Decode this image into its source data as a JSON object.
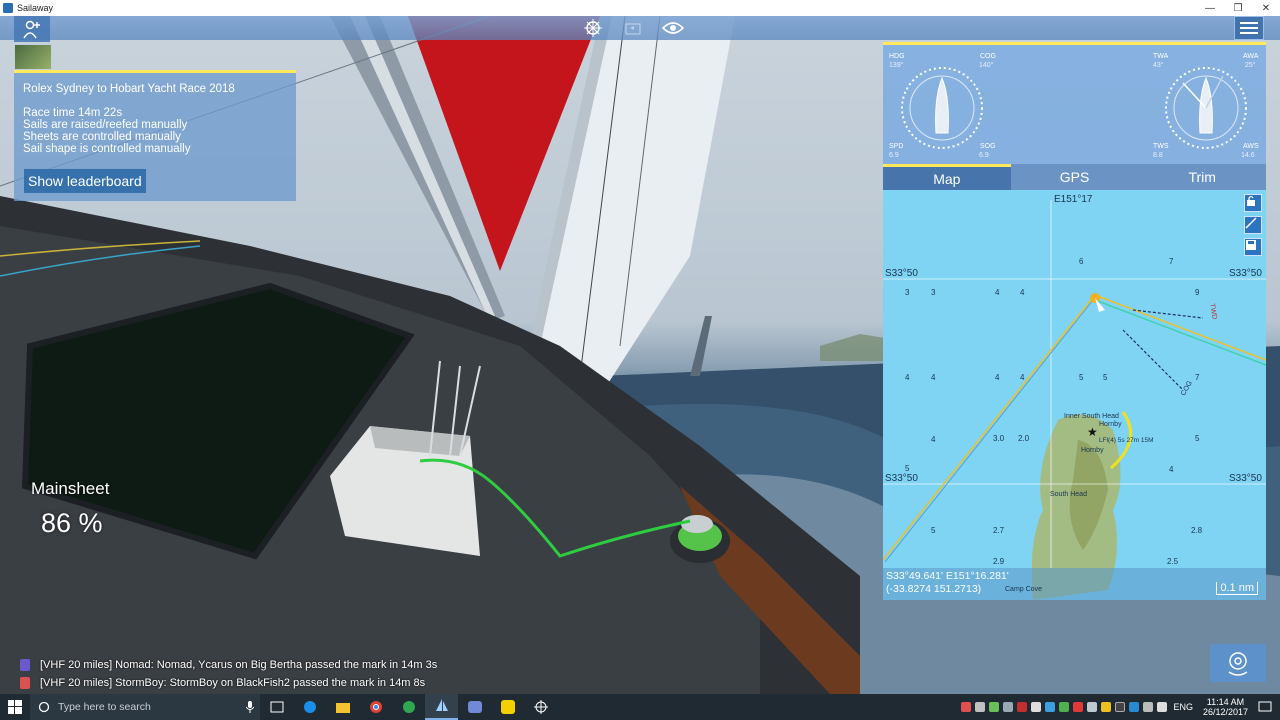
{
  "window": {
    "title": "Sailaway",
    "controls": [
      "—",
      "❐",
      "✕"
    ]
  },
  "race": {
    "title": "Rolex Sydney to Hobart Yacht Race 2018",
    "lines": [
      "Race time 14m 22s",
      "Sails are raised/reefed manually",
      "Sheets are controlled manually",
      "Sail shape is controlled manually"
    ],
    "leaderboard_button": "Show leaderboard"
  },
  "mainsheet": {
    "label": "Mainsheet",
    "value": "86 %"
  },
  "chat": [
    {
      "text": "[VHF 20 miles] Nomad: Nomad, Ycarus on Big Bertha passed the mark  in 14m 3s",
      "flag_color": "#6a5acd"
    },
    {
      "text": "[VHF 20 miles] StormBoy: StormBoy on BlackFish2  passed the mark  in 14m 8s",
      "flag_color": "#d9534f"
    }
  ],
  "instruments": {
    "left": {
      "hdg_label": "HDG",
      "hdg_value": "139°",
      "cog_label": "COG",
      "cog_value": "140°",
      "spd_label": "SPD",
      "spd_value": "6.9",
      "sog_label": "SOG",
      "sog_value": "6.9"
    },
    "right": {
      "twa_label": "TWA",
      "twa_value": "43°",
      "awa_label": "AWA",
      "awa_value": "25°",
      "tws_label": "TWS",
      "tws_value": "8.8",
      "aws_label": "AWS",
      "aws_value": "14.6"
    }
  },
  "tabs": [
    {
      "label": "Map",
      "active": true
    },
    {
      "label": "GPS",
      "active": false
    },
    {
      "label": "Trim",
      "active": false
    }
  ],
  "map": {
    "lon_label": "E151°17",
    "lat_label": "S33°50",
    "depths": [
      "3",
      "3",
      "4",
      "4",
      "6",
      "7",
      "9",
      "4",
      "4",
      "4",
      "4",
      "5",
      "5",
      "7",
      "4",
      "3.0",
      "2.0",
      "5",
      "5",
      "4",
      "5",
      "2.7",
      "2.8",
      "2.9",
      "2.5"
    ],
    "places": {
      "inner_south_head": "Inner South Head",
      "hornby": "Hornby",
      "hornby_light": "Hornby",
      "light_desc": "LFl(4) 5s 27m 15M",
      "south_head": "South Head",
      "camp_cove": "Camp Cove"
    },
    "labels": {
      "twd": "TWD",
      "cog": "COG"
    },
    "coords": {
      "line1": "S33°49.641' E151°16.281'",
      "line2": "(-33.8274 151.2713)"
    },
    "scale": "0.1 nm"
  },
  "taskbar": {
    "search_placeholder": "Type here to search",
    "language": "ENG",
    "time": "11:14 AM",
    "date": "26/12/2017"
  },
  "colors": {
    "accent_yellow": "#ffe95a",
    "panel_blue": "#6e9bcd",
    "sea": "#7fd4f4"
  }
}
